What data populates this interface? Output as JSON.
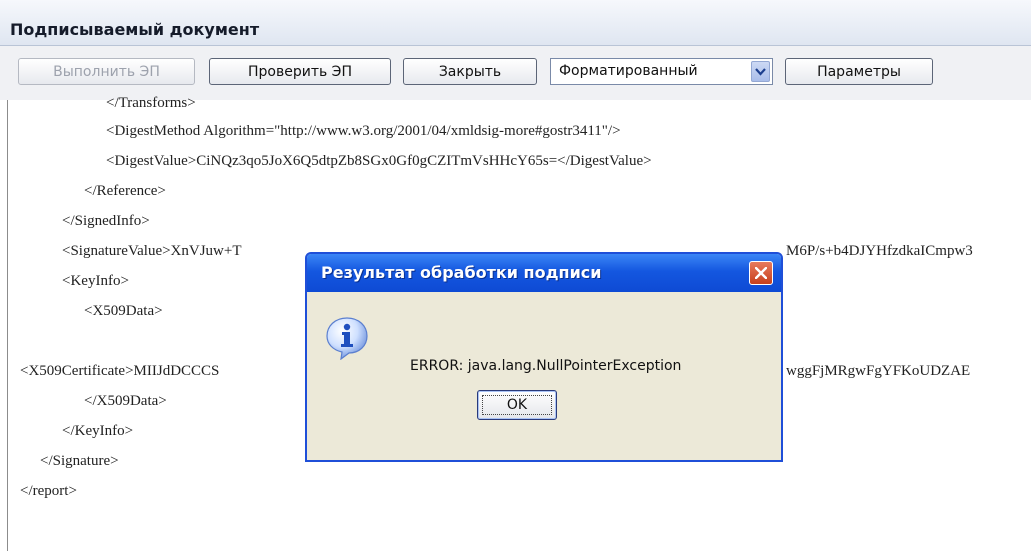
{
  "panel": {
    "title": "Подписываемый документ"
  },
  "toolbar": {
    "execute_label": "Выполнить ЭП",
    "verify_label": "Проверить ЭП",
    "close_label": "Закрыть",
    "format_selected": "Форматированный",
    "params_label": "Параметры"
  },
  "document": {
    "lines": [
      "</Transforms>",
      "<DigestMethod Algorithm=\"http://www.w3.org/2001/04/xmldsig-more#gostr3411\"/>",
      "<DigestValue>CiNQz3qo5JoX6Q5dtpZb8SGx0Gf0gCZITmVsHHcY65s=</DigestValue>",
      "</Reference>",
      "</SignedInfo>",
      "<SignatureValue>XnVJuw+T",
      "M6P/s+b4DJYHfzdkaICmpw3",
      "<KeyInfo>",
      "<X509Data>",
      "<X509Certificate>MIIJdDCCCS",
      "wggFjMRgwFgYFKoUDZAE",
      "</X509Data>",
      "</KeyInfo>",
      "</Signature>",
      "</report>"
    ]
  },
  "dialog": {
    "title": "Результат обработки подписи",
    "message": "ERROR: java.lang.NullPointerException",
    "ok_label": "OK"
  },
  "colors": {
    "dialog_titlebar": "#1457e0",
    "dialog_body": "#ece9d8",
    "close_button": "#c8401c"
  },
  "icons": {
    "dialog_icon": "info-icon",
    "close_icon": "close-icon",
    "dropdown_icon": "chevron-down-icon"
  }
}
